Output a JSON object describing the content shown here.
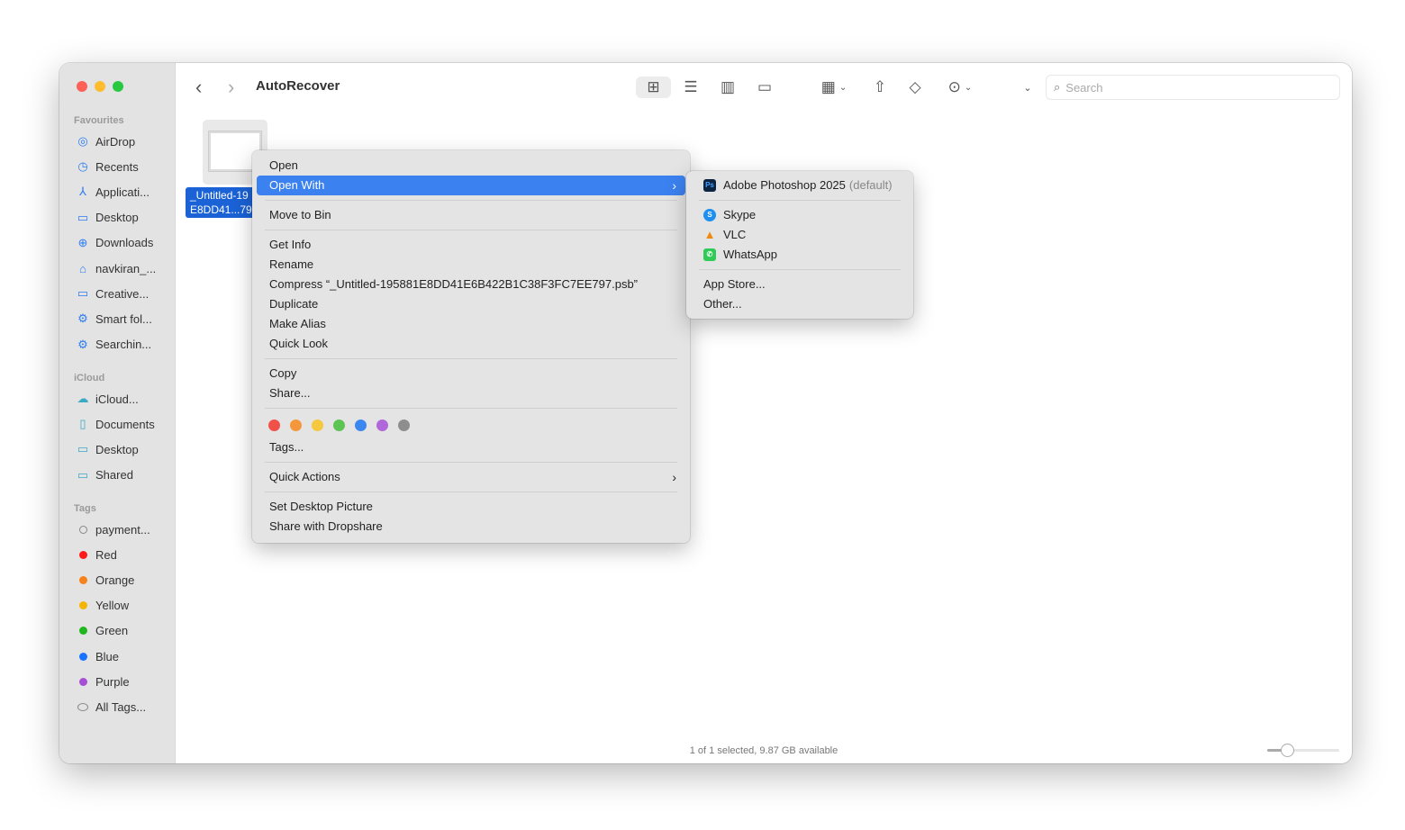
{
  "window": {
    "title": "AutoRecover"
  },
  "toolbar": {
    "search_placeholder": "Search"
  },
  "sidebar": {
    "favourites": {
      "header": "Favourites",
      "items": [
        {
          "label": "AirDrop",
          "icon": "airdrop-icon",
          "glyph": "◎"
        },
        {
          "label": "Recents",
          "icon": "clock-icon",
          "glyph": "◷"
        },
        {
          "label": "Applicati...",
          "icon": "applications-icon",
          "glyph": "⅄"
        },
        {
          "label": "Desktop",
          "icon": "desktop-icon",
          "glyph": "▭"
        },
        {
          "label": "Downloads",
          "icon": "download-icon",
          "glyph": "⊕"
        },
        {
          "label": "navkiran_...",
          "icon": "home-icon",
          "glyph": "⌂"
        },
        {
          "label": "Creative...",
          "icon": "folder-icon",
          "glyph": "▭"
        },
        {
          "label": "Smart fol...",
          "icon": "gear-icon",
          "glyph": "⚙"
        },
        {
          "label": "Searchin...",
          "icon": "gear-icon",
          "glyph": "⚙"
        }
      ]
    },
    "icloud": {
      "header": "iCloud",
      "items": [
        {
          "label": "iCloud...",
          "icon": "cloud-icon",
          "glyph": "☁"
        },
        {
          "label": "Documents",
          "icon": "document-icon",
          "glyph": "▯"
        },
        {
          "label": "Desktop",
          "icon": "desktop-icon",
          "glyph": "▭"
        },
        {
          "label": "Shared",
          "icon": "shared-folder-icon",
          "glyph": "▭"
        }
      ]
    },
    "tags": {
      "header": "Tags",
      "items": [
        {
          "label": "payment...",
          "color": ""
        },
        {
          "label": "Red",
          "color": "#ff1a1a"
        },
        {
          "label": "Orange",
          "color": "#f7821b"
        },
        {
          "label": "Yellow",
          "color": "#f5b400"
        },
        {
          "label": "Green",
          "color": "#1eb81e"
        },
        {
          "label": "Blue",
          "color": "#1a73ff"
        },
        {
          "label": "Purple",
          "color": "#a64fd6"
        },
        {
          "label": "All Tags...",
          "color": ""
        }
      ]
    }
  },
  "file": {
    "name_line1": "_Untitled-19",
    "name_line2": "E8DD41...79"
  },
  "context_menu": {
    "open": "Open",
    "open_with": "Open With",
    "move_to_bin": "Move to Bin",
    "get_info": "Get Info",
    "rename": "Rename",
    "compress": "Compress “_Untitled-195881E8DD41E6B422B1C38F3FC7EE797.psb”",
    "duplicate": "Duplicate",
    "make_alias": "Make Alias",
    "quick_look": "Quick Look",
    "copy": "Copy",
    "share": "Share...",
    "tag_colors": [
      "#f0524a",
      "#f4973a",
      "#f5c840",
      "#5cc453",
      "#3b87f0",
      "#b067d9",
      "#8e8e8e"
    ],
    "tags": "Tags...",
    "quick_actions": "Quick Actions",
    "set_desktop_picture": "Set Desktop Picture",
    "share_dropshare": "Share with Dropshare"
  },
  "open_with_menu": {
    "default_app": "Adobe Photoshop 2025",
    "default_suffix": "(default)",
    "apps": [
      "Skype",
      "VLC",
      "WhatsApp"
    ],
    "app_store": "App Store...",
    "other": "Other..."
  },
  "status": {
    "text": "1 of 1 selected, 9.87 GB available",
    "icon_size_slider": 0.27
  }
}
